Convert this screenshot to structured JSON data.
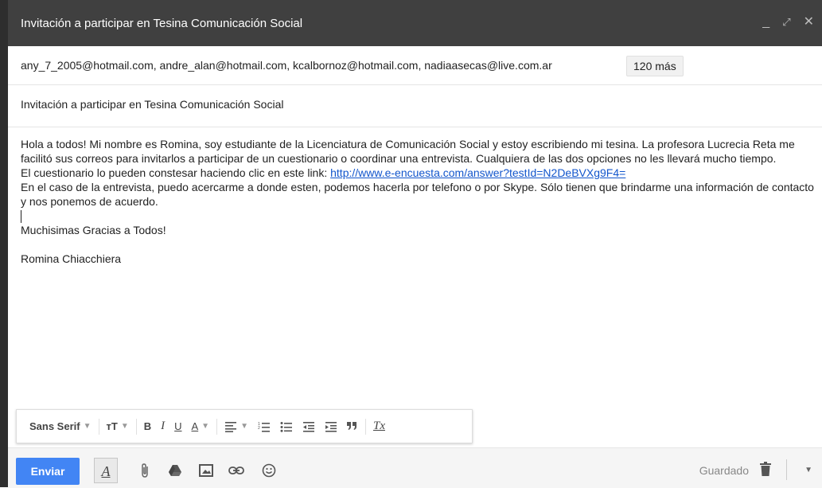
{
  "window": {
    "title": "Invitación a participar en Tesina Comunicación Social",
    "minimize": "_",
    "expand": "⤢",
    "close": "✕"
  },
  "recipients": {
    "text": "any_7_2005@hotmail.com, andre_alan@hotmail.com, kcalbornoz@hotmail.com, nadiaasecas@live.com.ar",
    "more": "120 más"
  },
  "subject": "Invitación a participar en Tesina Comunicación Social",
  "body": {
    "p1": "Hola a todos! Mi nombre es Romina, soy estudiante de la Licenciatura de Comunicación Social y estoy escribiendo mi tesina. La profesora Lucrecia Reta me facilitó sus correos para invitarlos a participar de un cuestionario o coordinar una entrevista. Cualquiera de las dos opciones no les llevará mucho tiempo.",
    "p2_prefix": "El cuestionario lo pueden constesar haciendo clic en este link: ",
    "link": "http://www.e-encuesta.com/answer?testId=N2DeBVXg9F4=",
    "p3": "En el caso de la entrevista, puedo acercarme a donde esten, podemos hacerla por telefono o por Skype. Sólo tienen que brindarme una información de contacto y nos ponemos de acuerdo.",
    "thanks": "Muchisimas Gracias a Todos!",
    "signature": "Romina Chiacchiera"
  },
  "format_bar": {
    "font": "Sans Serif",
    "size": "тT",
    "bold": "B",
    "italic": "I",
    "underline": "U",
    "text_color": "A",
    "clear": "Tx"
  },
  "bottom_bar": {
    "send": "Enviar",
    "format_toggle": "A",
    "saved": "Guardado"
  }
}
